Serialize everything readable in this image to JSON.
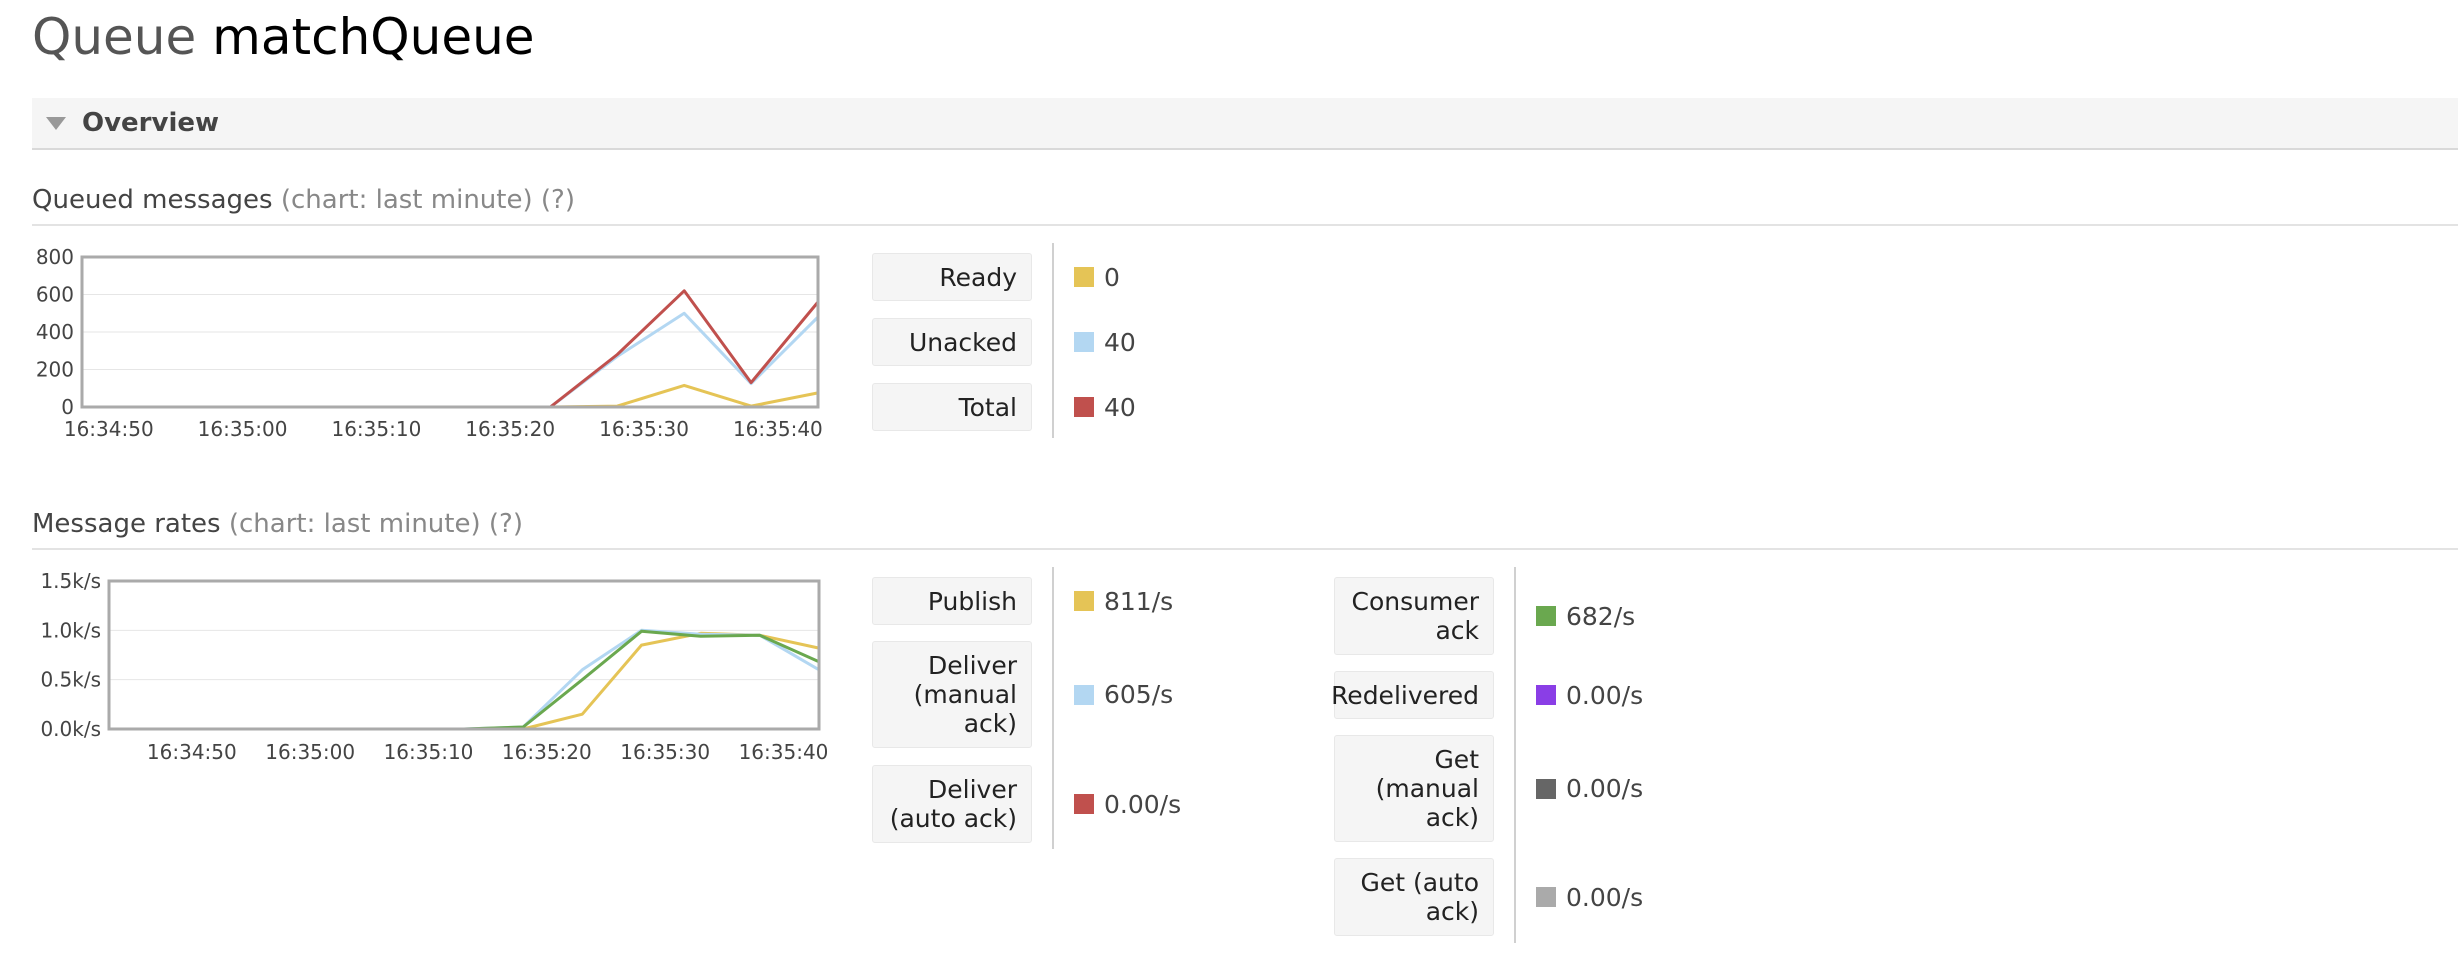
{
  "title": {
    "prefix": "Queue",
    "name": "matchQueue"
  },
  "overview": {
    "label": "Overview"
  },
  "queued": {
    "heading": "Queued messages",
    "subheading": "(chart: last minute) (?)",
    "stats": [
      {
        "label": "Ready",
        "value": "0",
        "color": "#e5c456"
      },
      {
        "label": "Unacked",
        "value": "40",
        "color": "#b3d7f2"
      },
      {
        "label": "Total",
        "value": "40",
        "color": "#c0504d"
      }
    ]
  },
  "rates": {
    "heading": "Message rates",
    "subheading": "(chart: last minute) (?)",
    "left_stats": [
      {
        "label": "Publish",
        "value": "811/s",
        "color": "#e5c456"
      },
      {
        "label": "Deliver (manual ack)",
        "value": "605/s",
        "color": "#b3d7f2"
      },
      {
        "label": "Deliver (auto ack)",
        "value": "0.00/s",
        "color": "#c0504d"
      }
    ],
    "right_stats": [
      {
        "label": "Consumer ack",
        "value": "682/s",
        "color": "#6aa84f"
      },
      {
        "label": "Redelivered",
        "value": "0.00/s",
        "color": "#8a3ee6"
      },
      {
        "label": "Get (manual ack)",
        "value": "0.00/s",
        "color": "#666666"
      },
      {
        "label": "Get (auto ack)",
        "value": "0.00/s",
        "color": "#aaaaaa"
      }
    ]
  },
  "chart_data": [
    {
      "type": "line",
      "title": "",
      "xlabel": "",
      "ylabel": "",
      "x": [
        "16:34:48",
        "16:34:53",
        "16:34:58",
        "16:35:03",
        "16:35:08",
        "16:35:13",
        "16:35:18",
        "16:35:23",
        "16:35:28",
        "16:35:33",
        "16:35:38",
        "16:35:43"
      ],
      "x_ticks": [
        "16:34:50",
        "16:35:00",
        "16:35:10",
        "16:35:20",
        "16:35:30",
        "16:35:40"
      ],
      "y_ticks": [
        "0",
        "200",
        "400",
        "600",
        "800"
      ],
      "ylim": [
        0,
        800
      ],
      "grid": true,
      "series": [
        {
          "name": "Ready",
          "color": "#e5c456",
          "values": [
            0,
            0,
            0,
            0,
            0,
            0,
            0,
            0,
            5,
            115,
            5,
            75
          ]
        },
        {
          "name": "Unacked",
          "color": "#b3d7f2",
          "values": [
            0,
            0,
            0,
            0,
            0,
            0,
            0,
            0,
            270,
            500,
            125,
            480
          ]
        },
        {
          "name": "Total",
          "color": "#c0504d",
          "values": [
            0,
            0,
            0,
            0,
            0,
            0,
            0,
            0,
            280,
            620,
            130,
            560
          ]
        }
      ]
    },
    {
      "type": "line",
      "title": "",
      "xlabel": "",
      "ylabel": "",
      "x": [
        "16:34:43",
        "16:34:48",
        "16:34:53",
        "16:34:58",
        "16:35:03",
        "16:35:08",
        "16:35:13",
        "16:35:18",
        "16:35:23",
        "16:35:28",
        "16:35:33",
        "16:35:38",
        "16:35:43"
      ],
      "x_ticks": [
        "16:34:50",
        "16:35:00",
        "16:35:10",
        "16:35:20",
        "16:35:30",
        "16:35:40"
      ],
      "y_ticks": [
        "0.0k/s",
        "0.5k/s",
        "1.0k/s",
        "1.5k/s"
      ],
      "ylim": [
        0,
        1500
      ],
      "grid": true,
      "series": [
        {
          "name": "Publish",
          "color": "#e5c456",
          "values": [
            0,
            0,
            0,
            0,
            0,
            0,
            0,
            0,
            150,
            850,
            970,
            950,
            820
          ]
        },
        {
          "name": "Deliver (manual ack)",
          "color": "#b3d7f2",
          "values": [
            0,
            0,
            0,
            0,
            0,
            0,
            0,
            20,
            600,
            1000,
            960,
            950,
            600
          ]
        },
        {
          "name": "Consumer ack",
          "color": "#6aa84f",
          "values": [
            0,
            0,
            0,
            0,
            0,
            0,
            0,
            20,
            500,
            990,
            940,
            950,
            682
          ]
        }
      ]
    }
  ]
}
